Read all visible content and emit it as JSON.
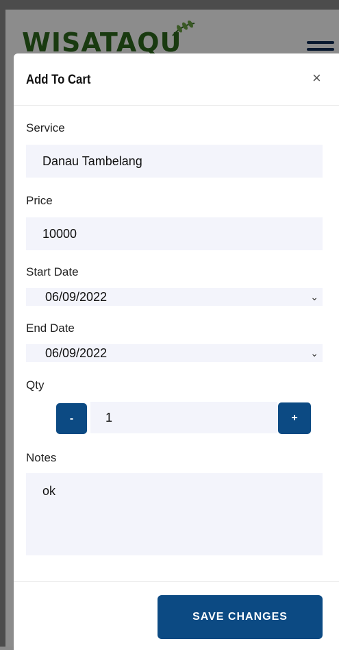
{
  "brand": {
    "logo_text": "WISATAQU"
  },
  "modal": {
    "title": "Add To Cart",
    "close_glyph": "×",
    "service": {
      "label": "Service",
      "value": "Danau Tambelang"
    },
    "price": {
      "label": "Price",
      "value": "10000"
    },
    "start_date": {
      "label": "Start Date",
      "value": "06/09/2022"
    },
    "end_date": {
      "label": "End Date",
      "value": "06/09/2022"
    },
    "qty": {
      "label": "Qty",
      "value": "1",
      "minus": "-",
      "plus": "+"
    },
    "notes": {
      "label": "Notes",
      "value": "ok"
    },
    "save_label": "SAVE CHANGES"
  },
  "colors": {
    "primary": "#0c4a83",
    "field_bg": "#f3f4fb",
    "logo_green": "#2e6b1e"
  },
  "icons": {
    "menu": "hamburger-icon",
    "close": "close-icon",
    "dropdown": "chevron-down-icon"
  }
}
